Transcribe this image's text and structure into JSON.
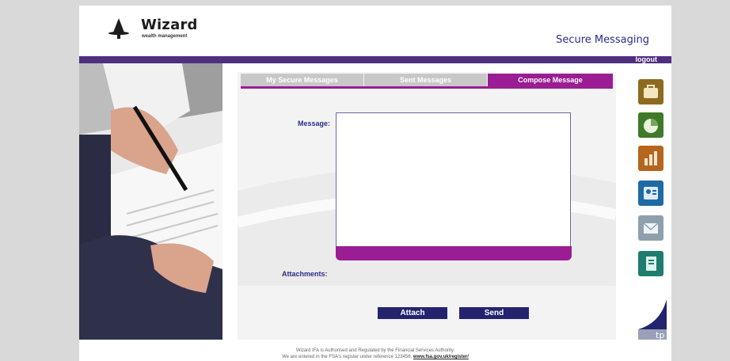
{
  "header": {
    "brand_name": "Wizard",
    "brand_tagline": "wealth management",
    "app_title": "Secure Messaging",
    "logout_label": "logout"
  },
  "tabs": [
    {
      "label": "My Secure Messages",
      "active": false
    },
    {
      "label": "Sent Messages",
      "active": false
    },
    {
      "label": "Compose Message",
      "active": true
    }
  ],
  "compose": {
    "message_label": "Message:",
    "message_value": "",
    "attachments_label": "Attachments:",
    "attach_button": "Attach",
    "send_button": "Send"
  },
  "side_icons": [
    {
      "name": "briefcase-icon",
      "color": "#8c6a1f"
    },
    {
      "name": "pie-chart-icon",
      "color": "#3f7a2a"
    },
    {
      "name": "bar-chart-icon",
      "color": "#b5651d"
    },
    {
      "name": "contacts-icon",
      "color": "#1f6aa5"
    },
    {
      "name": "envelope-icon",
      "color": "#8fa0ad"
    },
    {
      "name": "document-icon",
      "color": "#1e7d6d"
    }
  ],
  "powered_by": {
    "label": "tp"
  },
  "footer": {
    "line1": "Wizard IFA is Authorised and Regulated by the Financial Services Authority.",
    "line2_prefix": "We are entered in the FSA's register under reference 123456.",
    "line2_link": "www.fsa.gov.uk/register/"
  },
  "colors": {
    "accent_purple": "#9a1d93",
    "topbar": "#4e2f80",
    "button_navy": "#23236e",
    "label_blue": "#2c2c8a"
  }
}
